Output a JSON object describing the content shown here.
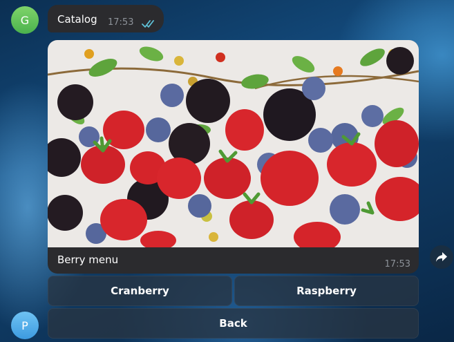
{
  "chat": {
    "sender_avatar_letter": "G",
    "user_avatar_letter": "P",
    "message_text": "Catalog",
    "message_time": "17:53",
    "media_caption": "Berry menu",
    "media_time": "17:53"
  },
  "keyboard": {
    "row1": [
      "Cranberry",
      "Raspberry"
    ],
    "back": "Back"
  },
  "icons": {
    "read_ticks": "double-check-icon",
    "share": "share-arrow-icon"
  },
  "colors": {
    "bubble": "#2b2b2e",
    "ticks": "#5fc2d8",
    "sender_avatar": "#5cbf52",
    "user_avatar": "#4aa8e8"
  }
}
